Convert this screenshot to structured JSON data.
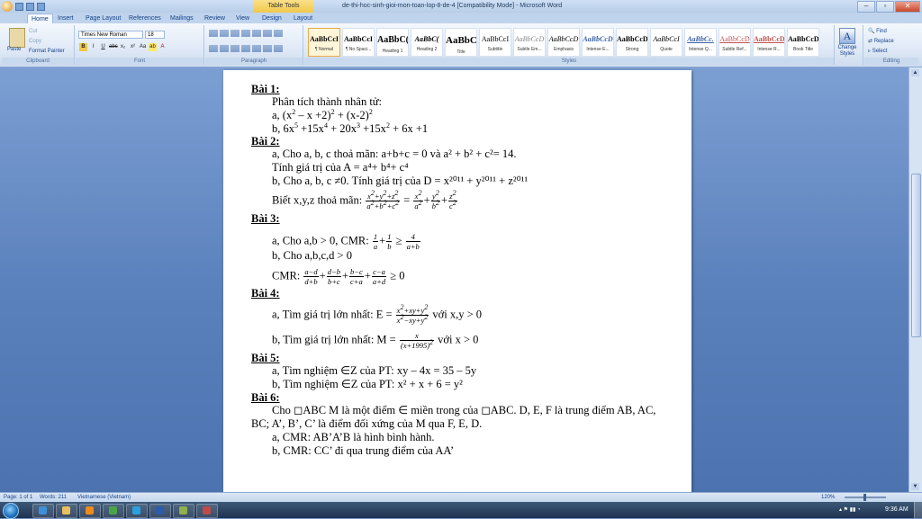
{
  "window": {
    "title": "de-thi-hoc-sinh-gioi-mon-toan-lop-8-de-4 [Compatibility Mode] - Microsoft Word",
    "context_tab": "Table Tools"
  },
  "tabs": [
    "Home",
    "Insert",
    "Page Layout",
    "References",
    "Mailings",
    "Review",
    "View",
    "Design",
    "Layout"
  ],
  "ribbon": {
    "clipboard": {
      "paste": "Paste",
      "cut": "Cut",
      "copy": "Copy",
      "format_painter": "Format Painter",
      "label": "Clipboard"
    },
    "font": {
      "name": "Times New Roman",
      "size": "18",
      "label": "Font"
    },
    "paragraph": {
      "label": "Paragraph"
    },
    "styles": {
      "label": "Styles",
      "items": [
        {
          "sample": "AaBbCcI",
          "name": "¶ Normal"
        },
        {
          "sample": "AaBbCcI",
          "name": "¶ No Spaci..."
        },
        {
          "sample": "AaBbC(",
          "name": "Heading 1"
        },
        {
          "sample": "AaBbC(",
          "name": "Heading 2"
        },
        {
          "sample": "AaBbC(",
          "name": "Title"
        },
        {
          "sample": "AaBbCcI",
          "name": "Subtitle"
        },
        {
          "sample": "AaBbCcD",
          "name": "Subtle Em..."
        },
        {
          "sample": "AaBbCcD",
          "name": "Emphasis"
        },
        {
          "sample": "AaBbCcD",
          "name": "Intense E..."
        },
        {
          "sample": "AaBbCcD",
          "name": "Strong"
        },
        {
          "sample": "AaBbCcI",
          "name": "Quote"
        },
        {
          "sample": "AaBbCc.",
          "name": "Intense Q..."
        },
        {
          "sample": "AaBbCcD",
          "name": "Subtle Ref..."
        },
        {
          "sample": "AaBbCcD",
          "name": "Intense R..."
        },
        {
          "sample": "AaBbCcD",
          "name": "Book Title"
        }
      ],
      "change_styles": "Change Styles"
    },
    "editing": {
      "find": "Find",
      "replace": "Replace",
      "select": "Select",
      "label": "Editing"
    }
  },
  "document": {
    "bai1": {
      "h": "Bài 1:",
      "intro": "Phân tích thành nhân tử:"
    },
    "bai2": {
      "h": "Bài 2:",
      "line1": "a, Cho a, b, c thoả mãn: a+b+c = 0 và a² + b² + c²= 14.",
      "tinh": "Tính giá trị của A = a⁴+ b⁴+ c⁴",
      "b": "b, Cho a, b, c ≠0. Tính giá trị của D = x²⁰¹¹ + y²⁰¹¹ + z²⁰¹¹",
      "biet": "Biết x,y,z thoả mãn:"
    },
    "bai3": {
      "h": "Bài 3:",
      "a": "a, Cho a,b > 0, CMR:",
      "b": "b, Cho a,b,c,d > 0",
      "cmr": "CMR:"
    },
    "bai4": {
      "h": "Bài 4:",
      "a": "a, Tìm giá trị lớn nhất: E =",
      "a_cond": "với x,y > 0",
      "b": "b, Tìm giá trị lớn nhất: M =",
      "b_cond": "với x > 0"
    },
    "bai5": {
      "h": "Bài 5:",
      "a": "a, Tìm nghiệm ∈Z của PT: xy – 4x = 35 – 5y",
      "b": "b, Tìm nghiệm ∈Z của PT: x² + x + 6 = y²"
    },
    "bai6": {
      "h": "Bài 6:",
      "l1": "Cho ◻ABC M là một điểm ∈ miền trong của ◻ABC. D, E, F là trung điểm AB, AC,",
      "l2": "BC; A’, B’, C’ là điểm đối xứng của M qua F, E, D.",
      "l3": "a, CMR: AB’A’B là hình bình hành.",
      "l4": "b, CMR: CC’ đi qua trung điểm của AA’"
    }
  },
  "status": {
    "page": "Page: 1 of 1",
    "words": "Words: 211",
    "language": "Vietnamese (Vietnam)",
    "zoom": "120%"
  },
  "taskbar": {
    "clock": "9:36 AM"
  }
}
